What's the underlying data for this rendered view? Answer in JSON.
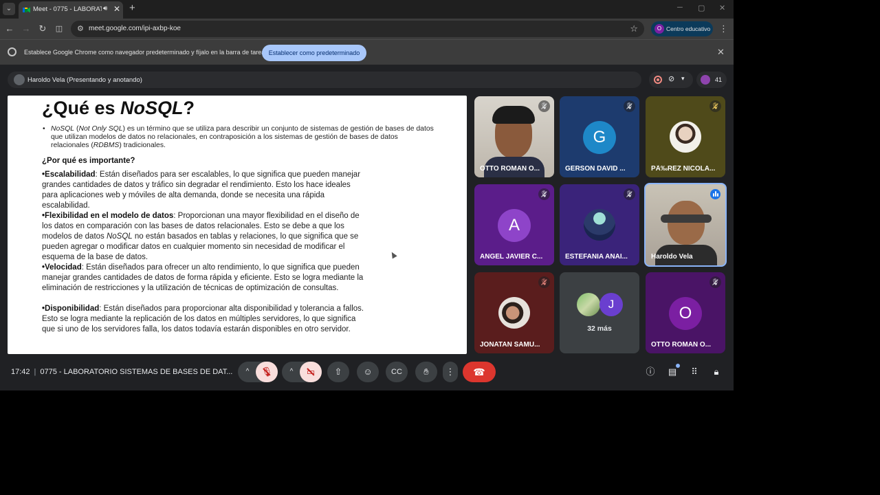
{
  "browser": {
    "tab_title": "Meet - 0775 - LABORATORIO",
    "url": "meet.google.com/ipi-axbp-koe",
    "profile_initial": "O",
    "profile_label": "Centro educativo"
  },
  "infobar": {
    "text": "Establece Google Chrome como navegador predeterminado y fíjalo en la barra de tareas",
    "button": "Establecer como predeterminado"
  },
  "meet": {
    "presenter": "Haroldo Vela (Presentando y anotando)",
    "participant_count": "41",
    "time": "17:42",
    "meeting_title": "0775 - LABORATORIO SISTEMAS DE BASES DE DAT..."
  },
  "slide": {
    "title_prefix": "¿Qué es ",
    "title_emph": "NoSQL",
    "title_suffix": "?",
    "bullet": {
      "t1": "NoSQL",
      "t2": " (",
      "t3": "Not Only SQL",
      "t4": ") es un término que se utiliza para describir un conjunto de sistemas de gestión de bases de datos que utilizan modelos de datos no relacionales, en contraposición a los sistemas de gestión de bases de datos relacionales (",
      "t5": "RDBMS",
      "t6": ") tradicionales."
    },
    "why_heading": "¿Por qué es importante?",
    "escalabilidad_label": "•Escalabilidad",
    "escalabilidad_text": ": Están diseñados para ser escalables, lo que significa que pueden manejar grandes cantidades de datos y tráfico sin degradar el rendimiento. Esto los hace ideales para aplicaciones web y móviles de alta demanda, donde se necesita una rápida escalabilidad.",
    "flexibilidad_label": "•Flexibilidad en el modelo de datos",
    "flexibilidad_text1": ": Proporcionan una mayor flexibilidad en el diseño de los datos en comparación con las bases de datos relacionales. Esto se debe a que los modelos de datos ",
    "flexibilidad_emph": "NoSQL",
    "flexibilidad_text2": " no están basados en tablas y relaciones, lo que significa que se pueden agregar o modificar datos en cualquier momento sin necesidad de modificar el esquema de la base de datos.",
    "velocidad_label": "•Velocidad",
    "velocidad_text": ": Están diseñados para ofrecer un alto rendimiento, lo que significa que pueden manejar grandes cantidades de datos de forma rápida y eficiente. Esto se logra mediante la eliminación de restricciones y la utilización de técnicas de optimización de consultas.",
    "disponibilidad_label": "•Disponibilidad",
    "disponibilidad_text": ": Están diseñados para proporcionar alta disponibilidad y tolerancia a fallos. Esto se logra mediante la replicación de los datos en múltiples servidores, lo que significa que si uno de los servidores falla, los datos todavía estarán disponibles en otro servidor."
  },
  "tiles": [
    {
      "name": "OTTO ROMAN O...",
      "kind": "video"
    },
    {
      "name": "GERSON DAVID ...",
      "kind": "letter",
      "letter": "G",
      "color": "#1e88c8"
    },
    {
      "name": "PÃ‰REZ NICOLA...",
      "kind": "photo"
    },
    {
      "name": "ANGEL JAVIER C...",
      "kind": "letter",
      "letter": "A",
      "color": "#8e44c9"
    },
    {
      "name": "ESTEFANIA ANAI...",
      "kind": "photo"
    },
    {
      "name": "Haroldo Vela",
      "kind": "video"
    },
    {
      "name": "JONATAN SAMU...",
      "kind": "photo"
    },
    {
      "name": "OTTO ROMAN O...",
      "kind": "letter",
      "letter": "O",
      "color": "#7b1fa2"
    }
  ],
  "more": {
    "letter": "J",
    "label": "32 más"
  },
  "colors": {
    "end_call": "#dc362e",
    "muted_bg": "#f9dedc",
    "speaking": "#1a73e8"
  }
}
